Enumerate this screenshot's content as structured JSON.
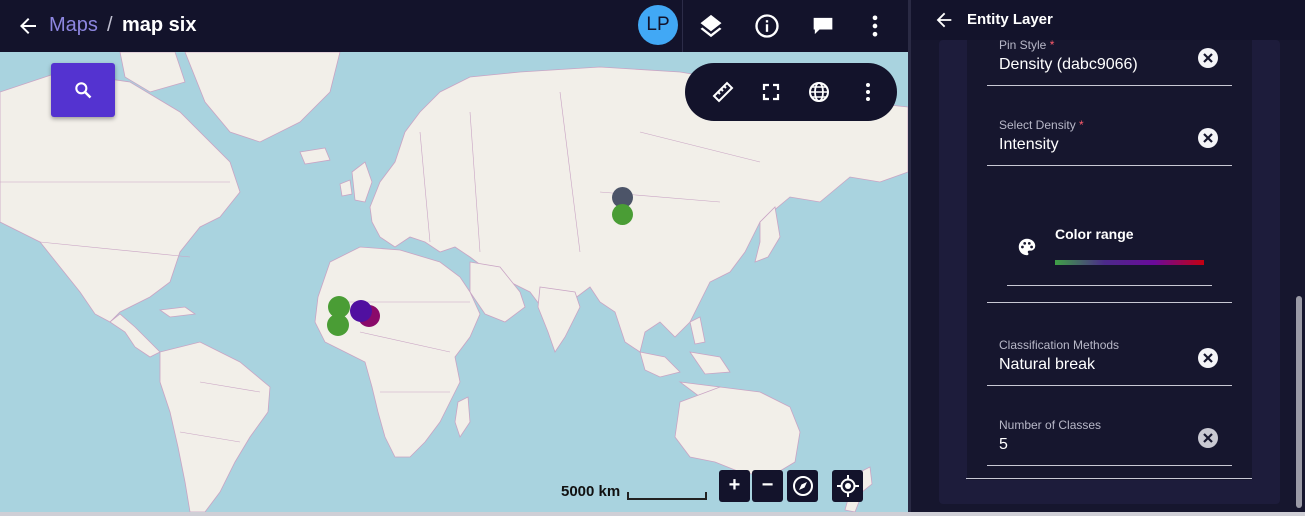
{
  "header": {
    "breadcrumb_root": "Maps",
    "separator": "/",
    "map_title": "map six",
    "avatar_initials": "LP",
    "icons": [
      "back-arrow-icon",
      "layers-icon",
      "info-icon",
      "comment-icon",
      "more-vert-icon"
    ]
  },
  "map": {
    "toolbar_icons": [
      "ruler-icon",
      "fullscreen-icon",
      "globe-icon",
      "more-vert-icon"
    ],
    "search_icon": "search-icon",
    "scale_label": "5000 km",
    "zoom_in": "+",
    "zoom_out": "−",
    "controls_icons": [
      "compass-icon",
      "locate-icon"
    ],
    "pin_colors": [
      "#4c5468",
      "#4a9d35",
      "#4a9d35",
      "#4a9d35",
      "#5010a0",
      "#8a0a6a"
    ]
  },
  "panel": {
    "title": "Entity Layer",
    "fields": [
      {
        "label": "Pin Style",
        "required": "*",
        "value": "Density (dabc9066)"
      },
      {
        "label": "Select Density",
        "required": "*",
        "value": "Intensity"
      },
      {
        "label": "Classification Methods",
        "required": "",
        "value": "Natural break"
      },
      {
        "label": "Number of Classes",
        "required": "",
        "value": "5"
      }
    ],
    "color_range": {
      "label": "Color range",
      "icon": "palette-icon",
      "gradient": [
        "#3fa046",
        "#4b2a8a",
        "#6a0a9a",
        "#c40010"
      ]
    }
  },
  "colors": {
    "app_bg": "#13132b",
    "accent": "#5433d0",
    "link": "#8d86e0",
    "water": "#a9d3df",
    "land": "#f2efe9"
  }
}
